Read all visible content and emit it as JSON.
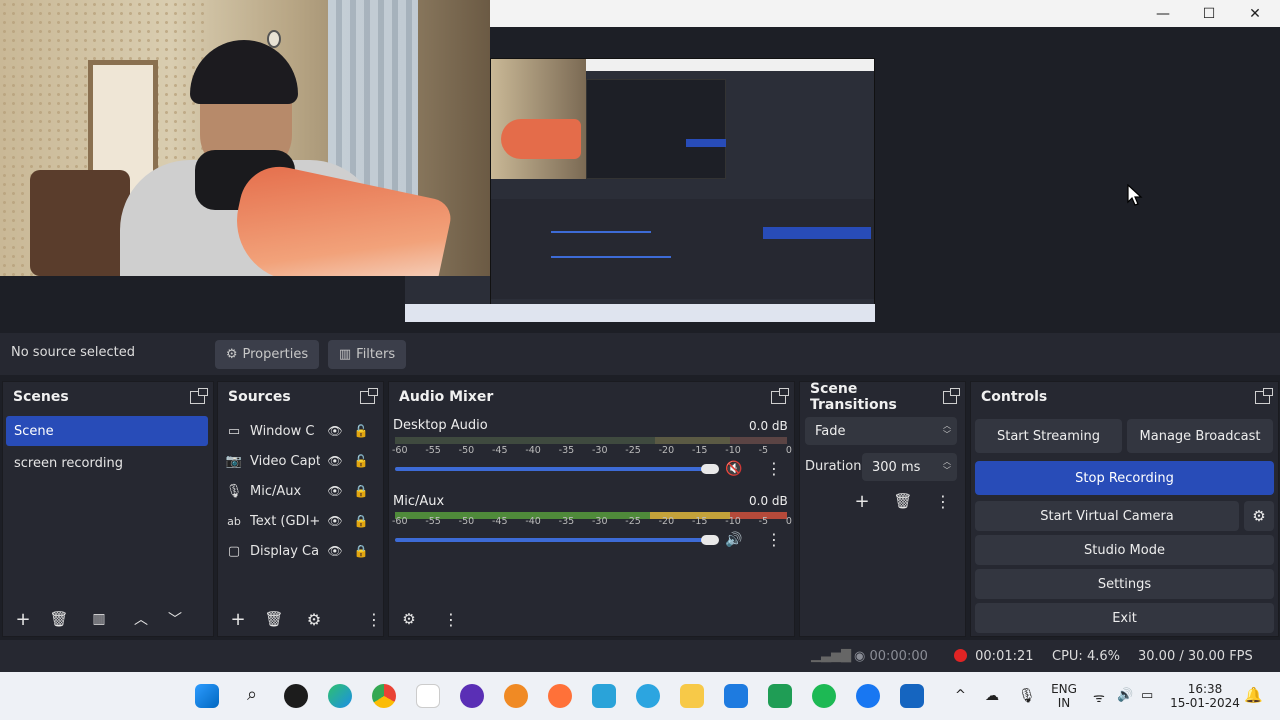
{
  "window": {
    "minimize": "—",
    "maximize": "☐",
    "close": "✕"
  },
  "props_bar": {
    "no_source": "No source selected",
    "properties": "Properties",
    "filters": "Filters"
  },
  "scenes": {
    "title": "Scenes",
    "items": [
      "Scene",
      "screen recording"
    ],
    "active_index": 0
  },
  "sources": {
    "title": "Sources",
    "items": [
      {
        "name": "Window C̈",
        "icon": "window-icon"
      },
      {
        "name": "Video Capt",
        "icon": "camera-icon"
      },
      {
        "name": "Mic/Aux",
        "icon": "mic-icon"
      },
      {
        "name": "Text (GDI+",
        "icon": "text-icon"
      },
      {
        "name": "Display Ca",
        "icon": "display-icon"
      }
    ]
  },
  "audio_mixer": {
    "title": "Audio Mixer",
    "channels": [
      {
        "name": "Desktop Audio",
        "db": "0.0 dB",
        "muted": true,
        "level": 0.85
      },
      {
        "name": "Mic/Aux",
        "db": "0.0 dB",
        "muted": false,
        "level": 0.85
      }
    ],
    "ticks": [
      "-60",
      "-55",
      "-50",
      "-45",
      "-40",
      "-35",
      "-30",
      "-25",
      "-20",
      "-15",
      "-10",
      "-5",
      "0"
    ]
  },
  "scene_transitions": {
    "title": "Scene Transitions",
    "transition": "Fade",
    "duration_label": "Duration",
    "duration_value": "300 ms"
  },
  "controls": {
    "title": "Controls",
    "start_streaming": "Start Streaming",
    "manage_broadcast": "Manage Broadcast",
    "stop_recording": "Stop Recording",
    "start_virtual_camera": "Start Virtual Camera",
    "studio_mode": "Studio Mode",
    "settings": "Settings",
    "exit": "Exit"
  },
  "status": {
    "stream_time": "00:00:00",
    "rec_time": "00:01:21",
    "cpu": "CPU: 4.6%",
    "fps": "30.00 / 30.00 FPS"
  },
  "taskbar": {
    "lang_top": "ENG",
    "lang_bottom": "IN",
    "time": "16:38",
    "date": "15-01-2024"
  },
  "colors": {
    "accent": "#284cb8",
    "record_red": "#e02424",
    "panel": "#262831",
    "background": "#1d1f26"
  }
}
